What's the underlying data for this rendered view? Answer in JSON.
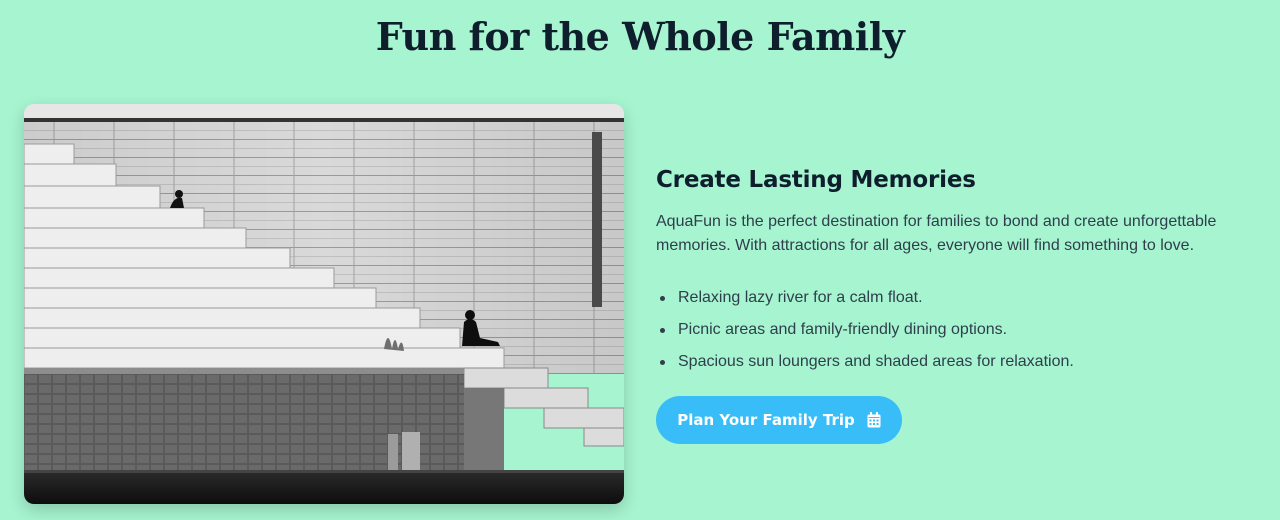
{
  "section": {
    "title": "Fun for the Whole Family"
  },
  "feature": {
    "image_subject": "family-stairs-photo",
    "heading": "Create Lasting Memories",
    "description": "AquaFun is the perfect destination for families to bond and create unforgettable memories. With attractions for all ages, everyone will find something to love.",
    "bullets": [
      "Relaxing lazy river for a calm float.",
      "Picnic areas and family-friendly dining options.",
      "Spacious sun loungers and shaded areas for relaxation."
    ]
  },
  "cta": {
    "label": "Plan Your Family Trip",
    "icon": "calendar-icon"
  },
  "colors": {
    "background": "#a6f4d0",
    "heading": "#0f1e2d",
    "body_text": "#2f3e4c",
    "button": "#38bdf8",
    "button_text": "#ffffff"
  }
}
